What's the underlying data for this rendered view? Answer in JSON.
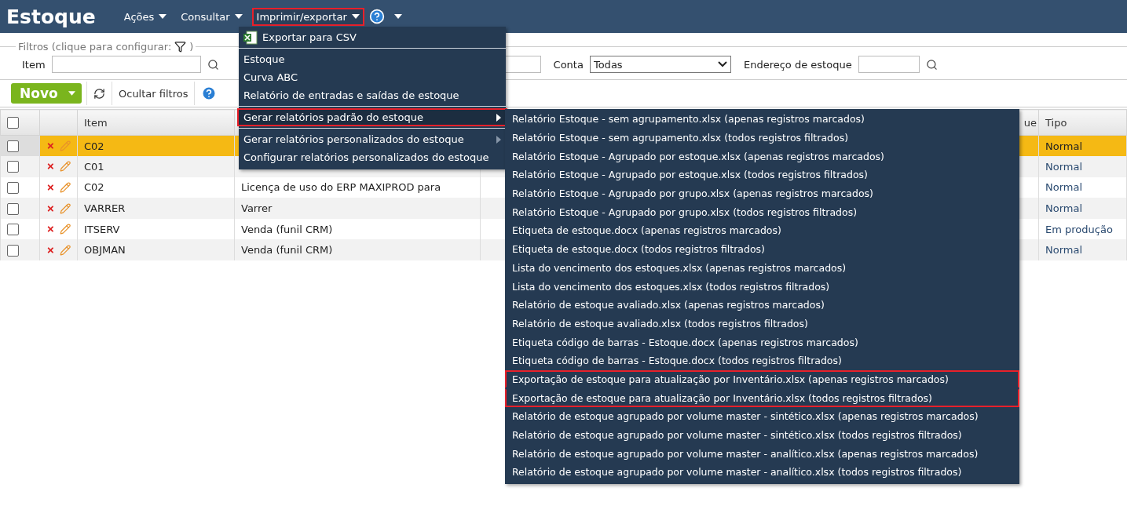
{
  "app_title": "Estoque",
  "menu_bar": [
    {
      "label": "Ações",
      "selected": false,
      "highlighted": false
    },
    {
      "label": "Consultar",
      "selected": false,
      "highlighted": false
    },
    {
      "label": "Imprimir/exportar",
      "selected": true,
      "highlighted": true
    }
  ],
  "filters": {
    "legend": "Filtros (clique para configurar:",
    "legend_close": ")",
    "fields": [
      {
        "kind": "text",
        "label": "Item",
        "search": true
      },
      {
        "kind": "text",
        "search": false
      },
      {
        "kind": "select",
        "label": "Conta",
        "value": "Todas"
      },
      {
        "kind": "text",
        "label": "Endereço de estoque",
        "search": true
      }
    ]
  },
  "toolbar": {
    "new_button": "Novo",
    "hide_filters": "Ocultar filtros"
  },
  "table": {
    "all_checked": false,
    "columns": {
      "item": "Item",
      "column_5": "ue",
      "tipo": "Tipo"
    },
    "rows": [
      {
        "checked": false,
        "selected": true,
        "item": "C02",
        "tipo": "Normal"
      },
      {
        "checked": false,
        "selected": false,
        "item": "C01",
        "tipo": "Normal"
      },
      {
        "checked": false,
        "selected": false,
        "item": "C02",
        "description": "Licença de uso do ERP MAXIPROD para",
        "tipo": "Normal"
      },
      {
        "checked": false,
        "selected": false,
        "item": "VARRER",
        "description": "Varrer",
        "tipo": "Normal"
      },
      {
        "checked": false,
        "selected": false,
        "item": "ITSERV",
        "description": "Venda (funil CRM)",
        "tipo": "Em produção"
      },
      {
        "checked": false,
        "selected": false,
        "item": "OBJMAN",
        "description": "Venda (funil CRM)",
        "tipo": "Normal"
      }
    ]
  },
  "print_menu": {
    "items": [
      {
        "kind": "csv",
        "label": "Exportar para CSV"
      },
      {
        "kind": "separator"
      },
      {
        "kind": "item",
        "label": "Estoque"
      },
      {
        "kind": "item",
        "label": "Curva ABC"
      },
      {
        "kind": "item",
        "label": "Relatório de entradas e saídas de estoque"
      },
      {
        "kind": "separator"
      },
      {
        "kind": "submenu",
        "label": "Gerar relatórios padrão do estoque",
        "selected": true,
        "highlighted": true
      },
      {
        "kind": "separator"
      },
      {
        "kind": "submenu",
        "label": "Gerar relatórios personalizados do estoque",
        "selected": false,
        "highlighted": false
      },
      {
        "kind": "item",
        "label": "Configurar relatórios personalizados do estoque"
      }
    ]
  },
  "submenu": {
    "items": [
      {
        "label": "Relatório Estoque - sem agrupamento.xlsx (apenas registros marcados)",
        "highlighted": false
      },
      {
        "label": "Relatório Estoque - sem agrupamento.xlsx (todos registros filtrados)",
        "highlighted": false
      },
      {
        "label": "Relatório Estoque - Agrupado por estoque.xlsx (apenas registros marcados)",
        "highlighted": false
      },
      {
        "label": "Relatório Estoque - Agrupado por estoque.xlsx (todos registros filtrados)",
        "highlighted": false
      },
      {
        "label": "Relatório Estoque - Agrupado por grupo.xlsx (apenas registros marcados)",
        "highlighted": false
      },
      {
        "label": "Relatório Estoque - Agrupado por grupo.xlsx (todos registros filtrados)",
        "highlighted": false
      },
      {
        "label": "Etiqueta de estoque.docx (apenas registros marcados)",
        "highlighted": false
      },
      {
        "label": "Etiqueta de estoque.docx (todos registros filtrados)",
        "highlighted": false
      },
      {
        "label": "Lista do vencimento dos estoques.xlsx (apenas registros marcados)",
        "highlighted": false
      },
      {
        "label": "Lista do vencimento dos estoques.xlsx (todos registros filtrados)",
        "highlighted": false
      },
      {
        "label": "Relatório de estoque avaliado.xlsx (apenas registros marcados)",
        "highlighted": false
      },
      {
        "label": "Relatório de estoque avaliado.xlsx (todos registros filtrados)",
        "highlighted": false
      },
      {
        "label": "Etiqueta código de barras - Estoque.docx (apenas registros marcados)",
        "highlighted": false
      },
      {
        "label": "Etiqueta código de barras - Estoque.docx (todos registros filtrados)",
        "highlighted": false
      },
      {
        "label": "Exportação de estoque para atualização por Inventário.xlsx (apenas registros marcados)",
        "highlighted": true
      },
      {
        "label": "Exportação de estoque para atualização por Inventário.xlsx (todos registros filtrados)",
        "highlighted": true
      },
      {
        "label": "Relatório de estoque agrupado por volume master - sintético.xlsx (apenas registros marcados)",
        "highlighted": false
      },
      {
        "label": "Relatório de estoque agrupado por volume master - sintético.xlsx (todos registros filtrados)",
        "highlighted": false
      },
      {
        "label": "Relatório de estoque agrupado por volume master - analítico.xlsx (apenas registros marcados)",
        "highlighted": false
      },
      {
        "label": "Relatório de estoque agrupado por volume master - analítico.xlsx (todos registros filtrados)",
        "highlighted": false
      }
    ]
  }
}
